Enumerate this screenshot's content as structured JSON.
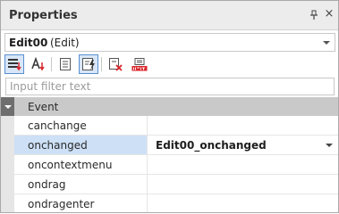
{
  "panel": {
    "title": "Properties",
    "pin_icon": "pin-icon",
    "close_icon": "close-icon",
    "close_glyph": "×"
  },
  "object_selector": {
    "name": "Edit00",
    "type": "(Edit)"
  },
  "toolbar": {
    "buttons": [
      {
        "icon": "categorized-sort-icon",
        "active": true
      },
      {
        "icon": "alphabetical-sort-icon",
        "active": false
      },
      {
        "icon": "properties-view-icon",
        "active": false
      },
      {
        "icon": "events-view-icon",
        "active": true
      },
      {
        "icon": "delete-event-icon",
        "active": false
      },
      {
        "icon": "init-icon",
        "active": false
      }
    ]
  },
  "filter": {
    "placeholder": "Input filter text",
    "value": ""
  },
  "grid": {
    "category": "Event",
    "rows": [
      {
        "name": "canchange",
        "value": ""
      },
      {
        "name": "onchanged",
        "value": "Edit00_onchanged"
      },
      {
        "name": "oncontextmenu",
        "value": ""
      },
      {
        "name": "ondrag",
        "value": ""
      },
      {
        "name": "ondragenter",
        "value": ""
      }
    ]
  },
  "colors": {
    "selection": "#cde0f6",
    "accent": "#5a8fd0",
    "init_red": "#d9262b"
  }
}
